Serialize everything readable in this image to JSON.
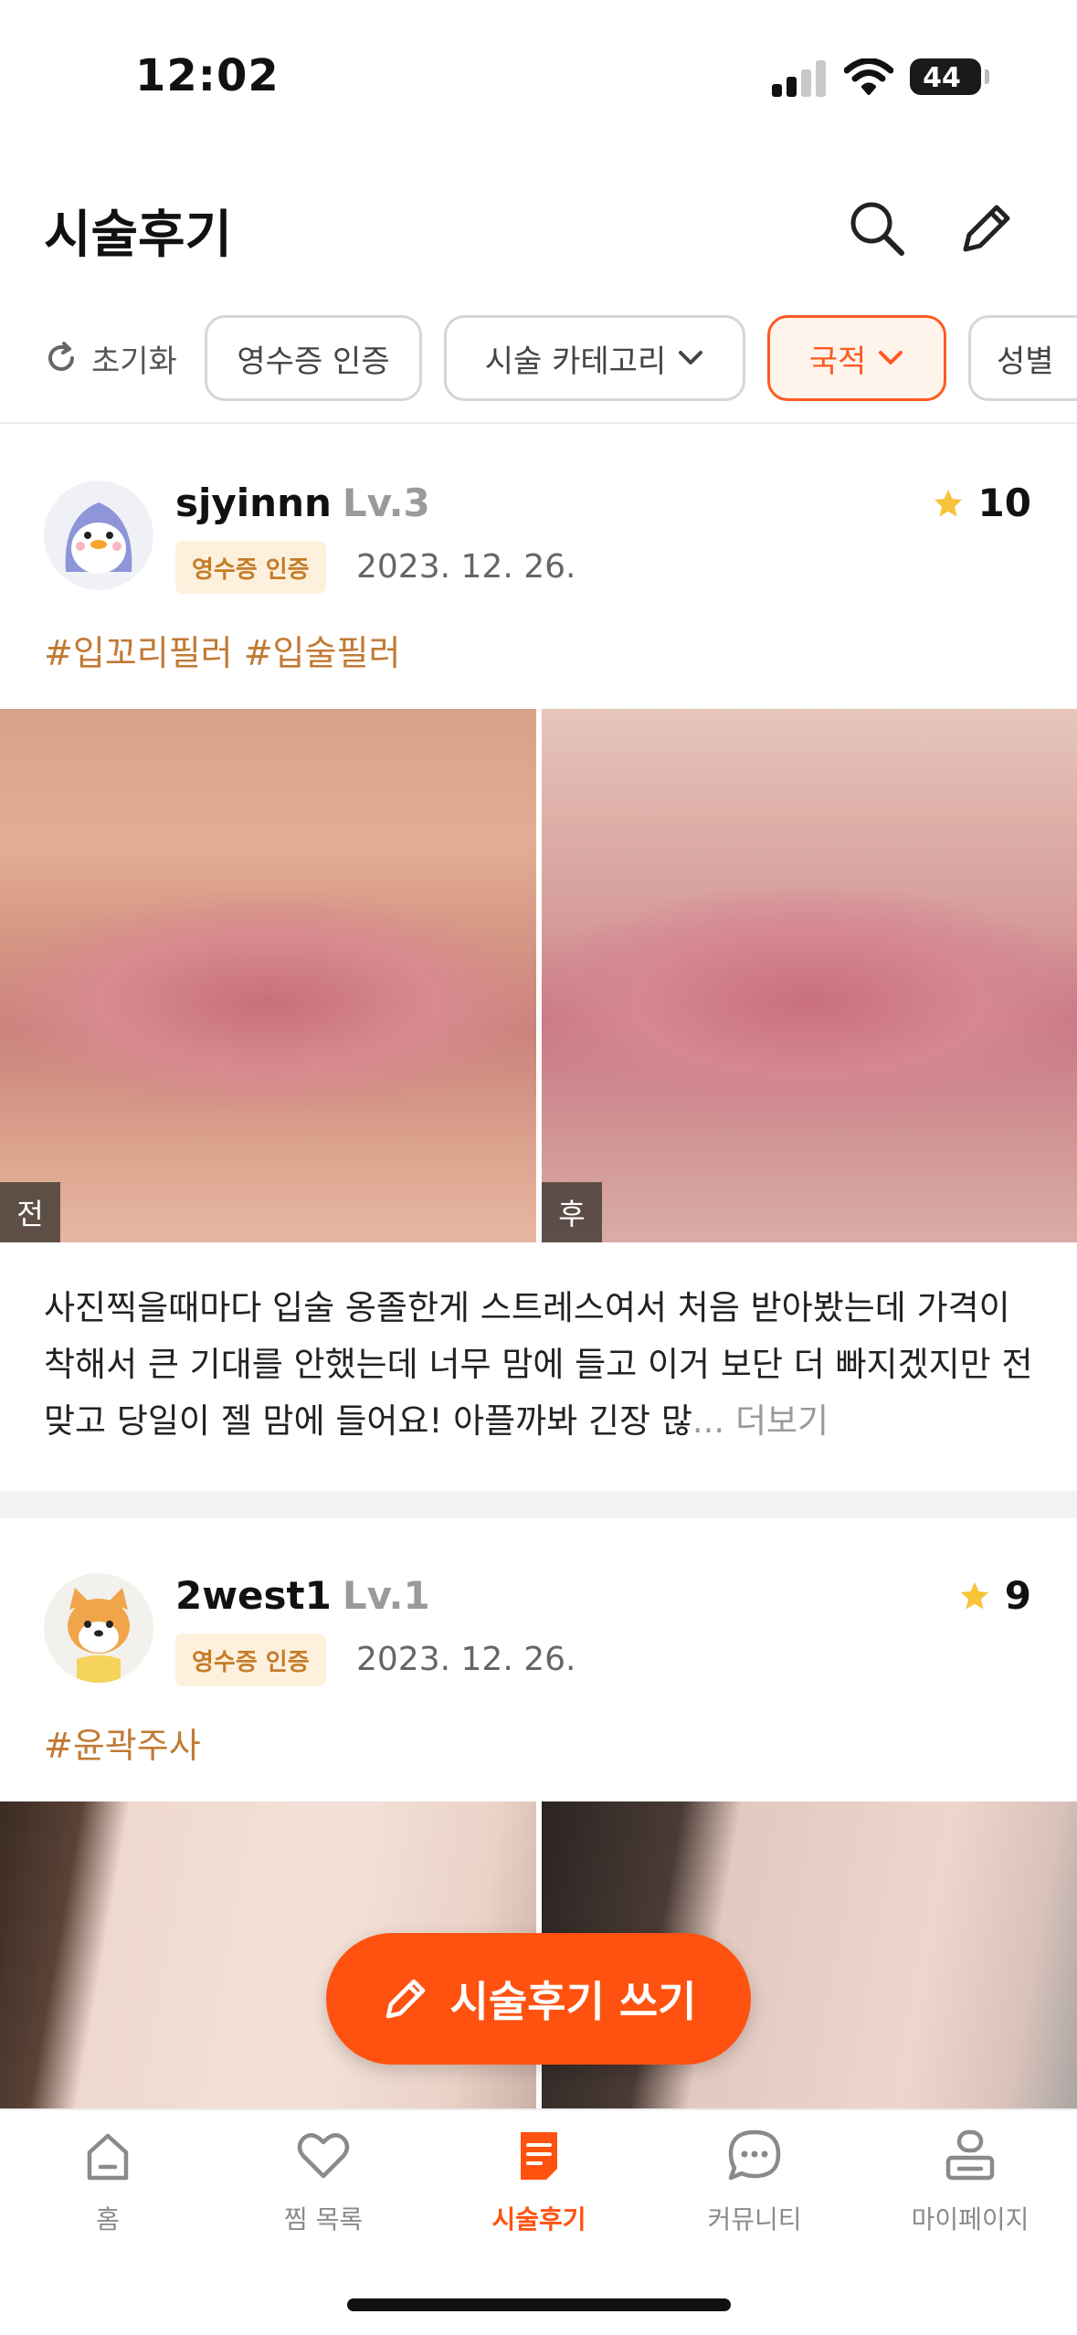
{
  "status_bar": {
    "time": "12:02",
    "battery": "44"
  },
  "header": {
    "title": "시술후기",
    "search_icon": "search-icon",
    "write_icon": "pencil-icon"
  },
  "filters": {
    "reset_label": "초기화",
    "chips": [
      {
        "label": "영수증 인증",
        "has_dropdown": false,
        "active": false
      },
      {
        "label": "시술 카테고리",
        "has_dropdown": true,
        "active": false
      },
      {
        "label": "국적",
        "has_dropdown": true,
        "active": true
      },
      {
        "label": "성별",
        "has_dropdown": false,
        "active": false
      }
    ]
  },
  "reviews": [
    {
      "username": "sjyinnn",
      "level": "Lv.3",
      "badge": "영수증 인증",
      "date": "2023. 12. 26.",
      "rating": "10",
      "hashtags": "#입꼬리필러 #입술필러",
      "before_label": "전",
      "after_label": "후",
      "text": "사진찍을때마다 입술 옹졸한게 스트레스여서 처음 받아봤는데 가격이 착해서 큰 기대를 안했는데 너무 맘에 들고 이거 보단 더 빠지겠지만 전 맞고 당일이 젤 맘에 들어요! 아플까봐 긴장 많",
      "ellipsis": "...",
      "more": "더보기",
      "avatar_icon": "penguin-avatar-icon"
    },
    {
      "username": "2west1",
      "level": "Lv.1",
      "badge": "영수증 인증",
      "date": "2023. 12. 26.",
      "rating": "9",
      "hashtags": "#윤곽주사",
      "avatar_icon": "shiba-avatar-icon"
    }
  ],
  "fab": {
    "label": "시술후기 쓰기"
  },
  "bottom_nav": [
    {
      "label": "홈",
      "icon": "home-icon",
      "active": false
    },
    {
      "label": "찜 목록",
      "icon": "heart-icon",
      "active": false
    },
    {
      "label": "시술후기",
      "icon": "document-icon",
      "active": true
    },
    {
      "label": "커뮤니티",
      "icon": "chat-icon",
      "active": false
    },
    {
      "label": "마이페이지",
      "icon": "profile-icon",
      "active": false
    }
  ],
  "colors": {
    "accent": "#ff5210",
    "hashtag": "#c27a35",
    "badge_bg": "#fdf1de",
    "star": "#f7c338"
  }
}
